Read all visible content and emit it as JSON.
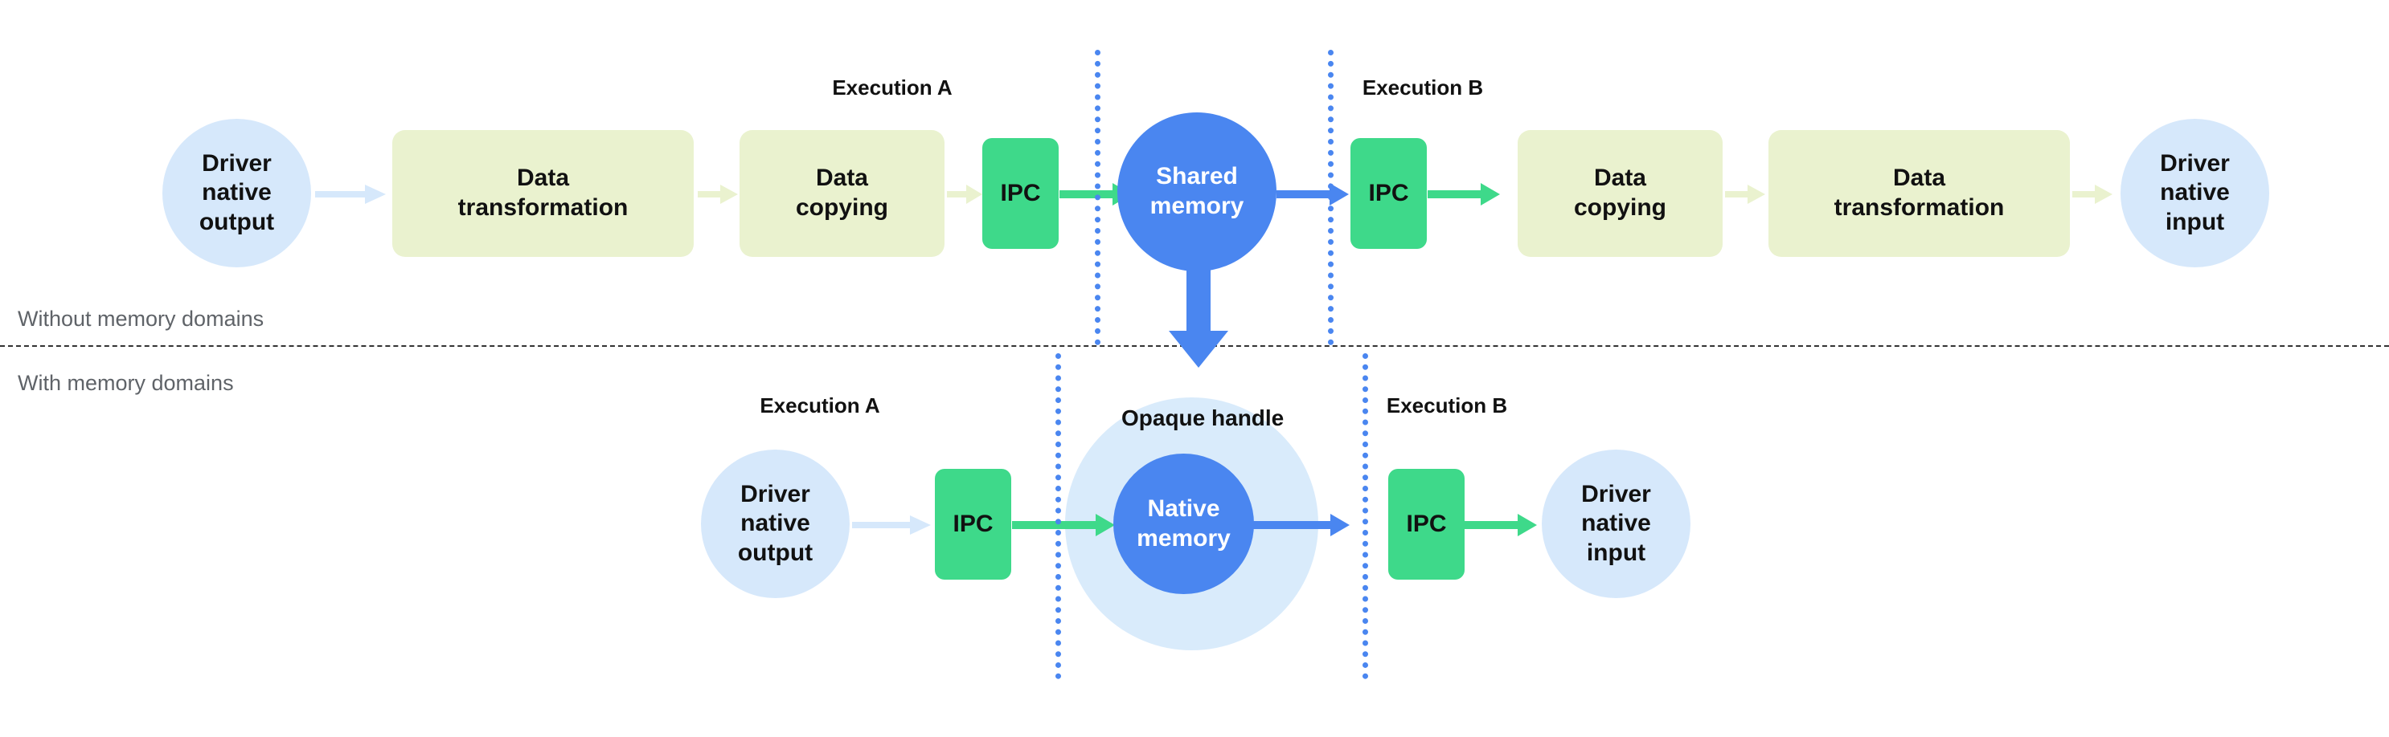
{
  "diagram": {
    "title": "Memory domains data flow comparison",
    "colors": {
      "blue": "#4a86f0",
      "light_blue": "#d6e8fb",
      "pale_blue": "#d9ebfb",
      "green": "#3ed98a",
      "pale_green": "#eaf2cf",
      "gray_text": "#5f6368",
      "divider": "#333333"
    },
    "side_labels": {
      "top": "Without memory domains",
      "bottom": "With memory domains"
    },
    "top_row": {
      "exec_a_label": "Execution A",
      "exec_b_label": "Execution B",
      "nodes": [
        {
          "id": "driver-native-output",
          "label": "Driver\nnative\noutput",
          "shape": "circle",
          "color": "light_blue"
        },
        {
          "id": "data-transformation-a",
          "label": "Data\ntransformation",
          "shape": "rounded-rect",
          "color": "pale_green"
        },
        {
          "id": "data-copying-a",
          "label": "Data\ncopying",
          "shape": "rounded-rect",
          "color": "pale_green"
        },
        {
          "id": "ipc-a",
          "label": "IPC",
          "shape": "rounded-rect",
          "color": "green"
        },
        {
          "id": "shared-memory",
          "label": "Shared\nmemory",
          "shape": "circle",
          "color": "blue"
        },
        {
          "id": "ipc-b",
          "label": "IPC",
          "shape": "rounded-rect",
          "color": "green"
        },
        {
          "id": "data-copying-b",
          "label": "Data\ncopying",
          "shape": "rounded-rect",
          "color": "pale_green"
        },
        {
          "id": "data-transformation-b",
          "label": "Data\ntransformation",
          "shape": "rounded-rect",
          "color": "pale_green"
        },
        {
          "id": "driver-native-input",
          "label": "Driver\nnative\ninput",
          "shape": "circle",
          "color": "light_blue"
        }
      ]
    },
    "bottom_row": {
      "exec_a_label": "Execution A",
      "exec_b_label": "Execution B",
      "opaque_handle_label": "Opaque handle",
      "nodes": [
        {
          "id": "driver-native-output-2",
          "label": "Driver\nnative\noutput",
          "shape": "circle",
          "color": "light_blue"
        },
        {
          "id": "ipc-a-2",
          "label": "IPC",
          "shape": "rounded-rect",
          "color": "green"
        },
        {
          "id": "native-memory",
          "label": "Native\nmemory",
          "shape": "circle",
          "color": "blue"
        },
        {
          "id": "ipc-b-2",
          "label": "IPC",
          "shape": "rounded-rect",
          "color": "green"
        },
        {
          "id": "driver-native-input-2",
          "label": "Driver\nnative\ninput",
          "shape": "circle",
          "color": "light_blue"
        }
      ]
    },
    "text": {
      "driver_native_output_line1": "Driver",
      "driver_native_output_line2": "native",
      "driver_native_output_line3": "output",
      "driver_native_input_line1": "Driver",
      "driver_native_input_line2": "native",
      "driver_native_input_line3": "input",
      "data_line": "Data",
      "transformation_line": "transformation",
      "copying_line": "copying",
      "ipc": "IPC",
      "shared_line1": "Shared",
      "shared_line2": "memory",
      "native_line1": "Native",
      "native_line2": "memory",
      "opaque_handle": "Opaque handle",
      "execution_a": "Execution A",
      "execution_b": "Execution B",
      "without_memory_domains": "Without memory domains",
      "with_memory_domains": "With memory domains"
    }
  }
}
